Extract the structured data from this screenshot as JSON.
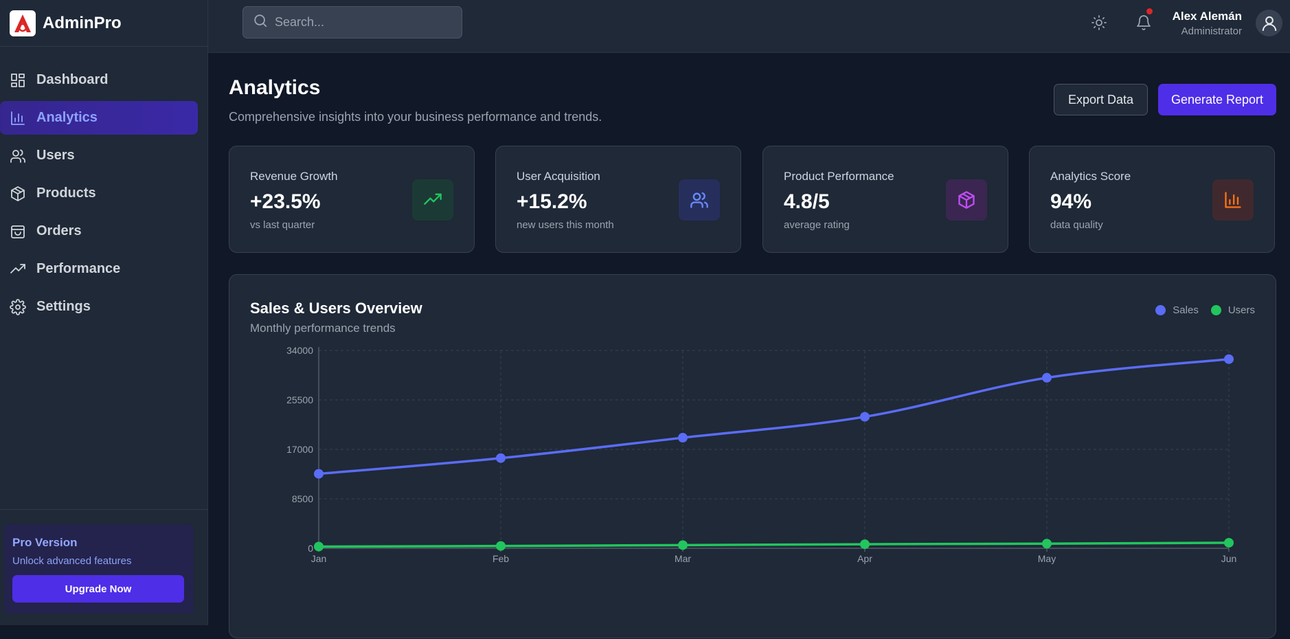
{
  "app": {
    "name": "AdminPro"
  },
  "search": {
    "placeholder": "Search..."
  },
  "user": {
    "name": "Alex Alemán",
    "role": "Administrator"
  },
  "sidebar": {
    "items": [
      {
        "label": "Dashboard",
        "icon": "dashboard-icon",
        "active": false
      },
      {
        "label": "Analytics",
        "icon": "bar-chart-icon",
        "active": true
      },
      {
        "label": "Users",
        "icon": "users-icon",
        "active": false
      },
      {
        "label": "Products",
        "icon": "box-icon",
        "active": false
      },
      {
        "label": "Orders",
        "icon": "shopping-bag-icon",
        "active": false
      },
      {
        "label": "Performance",
        "icon": "trending-up-icon",
        "active": false
      },
      {
        "label": "Settings",
        "icon": "gear-icon",
        "active": false
      }
    ],
    "pro": {
      "title": "Pro Version",
      "subtitle": "Unlock advanced features",
      "button": "Upgrade Now"
    }
  },
  "page": {
    "title": "Analytics",
    "subtitle": "Comprehensive insights into your business performance and trends.",
    "export_label": "Export Data",
    "report_label": "Generate Report"
  },
  "stats": [
    {
      "label": "Revenue Growth",
      "value": "+23.5%",
      "note": "vs last quarter",
      "icon": "trending-up-icon",
      "color": "#22c55e",
      "bg": "#1b3a36"
    },
    {
      "label": "User Acquisition",
      "value": "+15.2%",
      "note": "new users this month",
      "icon": "users-icon",
      "color": "#6b8afd",
      "bg": "#262f5c"
    },
    {
      "label": "Product Performance",
      "value": "4.8/5",
      "note": "average rating",
      "icon": "box-icon",
      "color": "#c14df5",
      "bg": "#3a2651"
    },
    {
      "label": "Analytics Score",
      "value": "94%",
      "note": "data quality",
      "icon": "bar-chart-icon",
      "color": "#f97316",
      "bg": "#40292e"
    }
  ],
  "chart": {
    "title": "Sales & Users Overview",
    "subtitle": "Monthly performance trends"
  },
  "colors": {
    "accent": "#4f2ee8",
    "sales": "#5b6cf6",
    "users": "#22c55e"
  },
  "chart_data": {
    "type": "line",
    "categories": [
      "Jan",
      "Feb",
      "Mar",
      "Apr",
      "May",
      "Jun"
    ],
    "series": [
      {
        "name": "Sales",
        "values": [
          12800,
          15500,
          19000,
          22600,
          29300,
          32500
        ]
      },
      {
        "name": "Users",
        "values": [
          300,
          400,
          550,
          700,
          800,
          950
        ]
      }
    ],
    "ylim": [
      0,
      34000
    ],
    "yticks": [
      "0",
      "8500",
      "17000",
      "25500",
      "34000"
    ],
    "grid": true,
    "legend": "top-right"
  }
}
